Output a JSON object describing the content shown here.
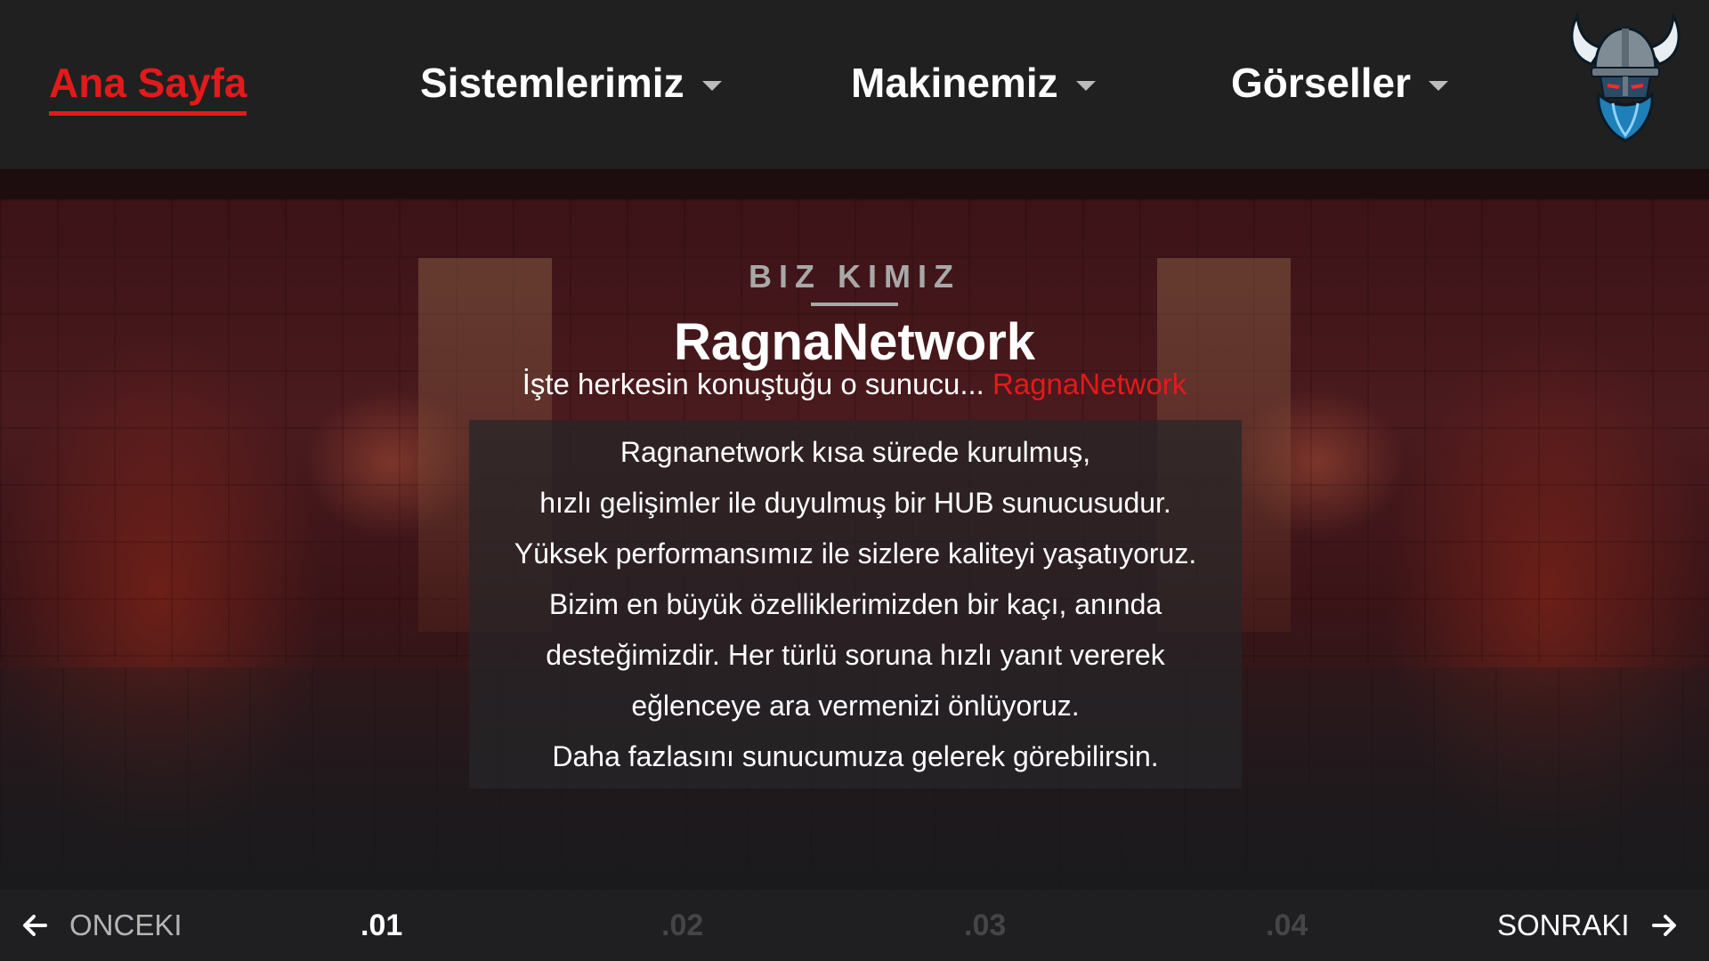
{
  "nav": {
    "items": [
      {
        "label": "Ana Sayfa",
        "active": true,
        "has_dropdown": false
      },
      {
        "label": "Sistemlerimiz",
        "active": false,
        "has_dropdown": true
      },
      {
        "label": "Makinemiz",
        "active": false,
        "has_dropdown": true
      },
      {
        "label": "Görseller",
        "active": false,
        "has_dropdown": true
      }
    ],
    "logo_icon": "viking-warrior-logo-icon"
  },
  "hero": {
    "section_label": "BIZ KIMIZ",
    "title": "RagnaNetwork",
    "tagline_prefix": "İşte herkesin konuştuğu o sunucu... ",
    "tagline_accent": "RagnaNetwork",
    "description_lines": [
      "Ragnanetwork kısa sürede kurulmuş,",
      "hızlı gelişimler ile duyulmuş bir HUB sunucusudur.",
      "Yüksek performansımız ile sizlere kaliteyi yaşatıyoruz.",
      "Bizim en büyük özelliklerimizden bir kaçı,  anında",
      "desteğimizdir. Her türlü soruna hızlı yanıt vererek",
      "eğlenceye ara vermenizi önlüyoruz.",
      "Daha fazlasını sunucumuza gelerek görebilirsin."
    ]
  },
  "pager": {
    "prev_label": "ONCEKI",
    "next_label": "SONRAKI",
    "prev_icon": "arrow-left-icon",
    "next_icon": "arrow-right-icon",
    "pages": [
      ".01",
      ".02",
      ".03",
      ".04"
    ],
    "current": ".01"
  },
  "colors": {
    "accent": "#e21a1a",
    "nav_bg": "#202020",
    "footer_bg": "#1f1f21",
    "inactive_page": "#454548",
    "section_label": "#a8a8a8"
  }
}
